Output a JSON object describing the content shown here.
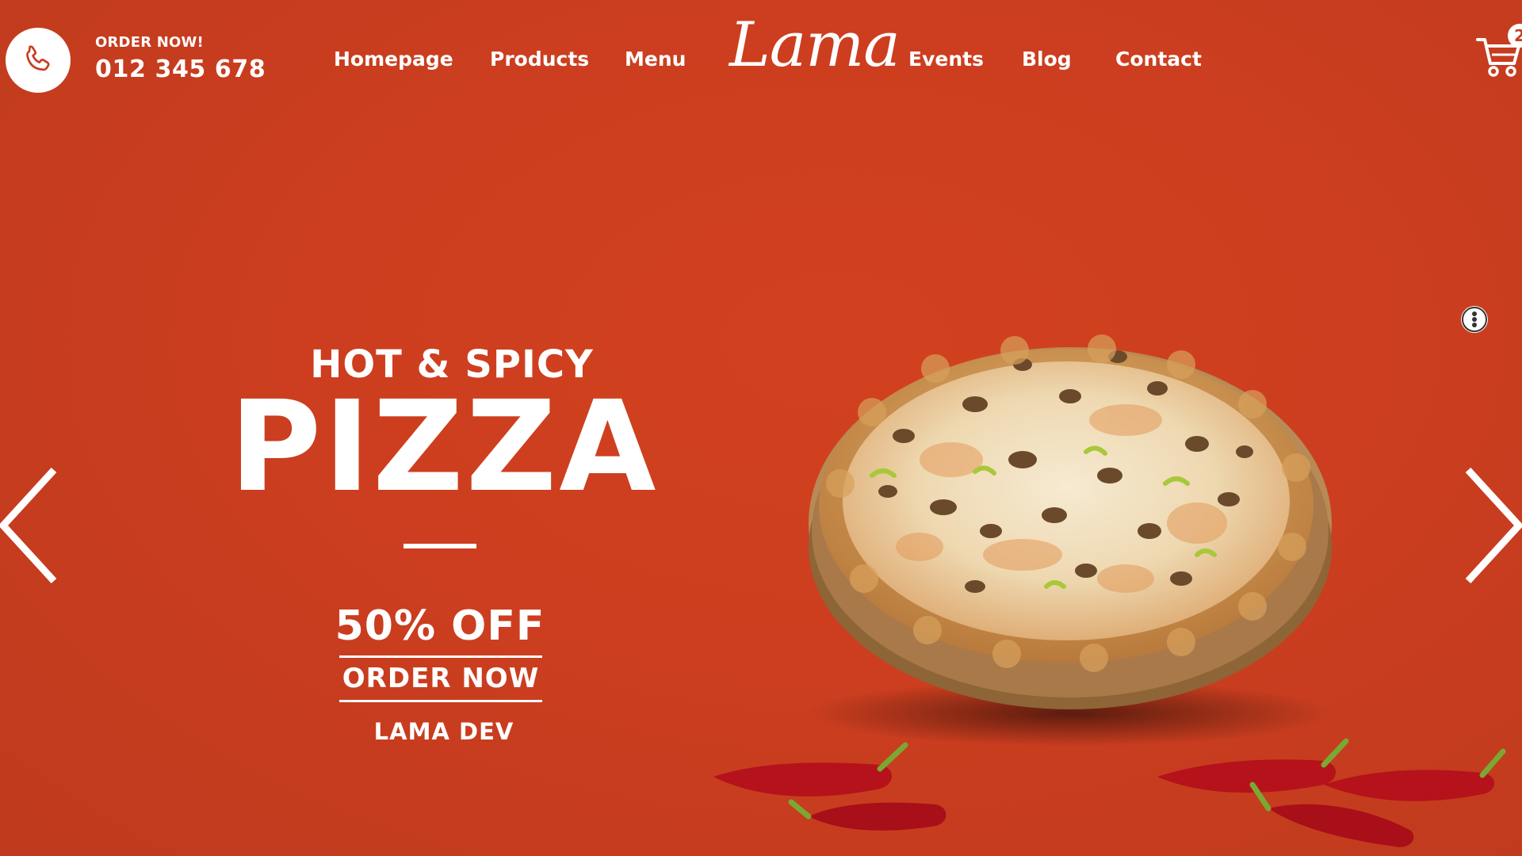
{
  "header": {
    "order_label": "ORDER NOW!",
    "phone_number": "012 345 678",
    "logo": "Lama",
    "cart_count": "2",
    "nav_left": [
      {
        "label": "Homepage"
      },
      {
        "label": "Products"
      },
      {
        "label": "Menu"
      }
    ],
    "nav_right": [
      {
        "label": "Events"
      },
      {
        "label": "Blog"
      },
      {
        "label": "Contact"
      }
    ]
  },
  "hero": {
    "subtitle": "HOT & SPICY",
    "title": "PIZZA",
    "discount": "50% OFF",
    "cta": "ORDER NOW",
    "brand": "LAMA DEV"
  },
  "icons": {
    "phone": "phone-icon",
    "cart": "cart-icon",
    "prev": "chevron-left-icon",
    "next": "chevron-right-icon",
    "more": "more-vertical-icon"
  },
  "colors": {
    "background": "#cc3e1f",
    "text": "#ffffff"
  }
}
